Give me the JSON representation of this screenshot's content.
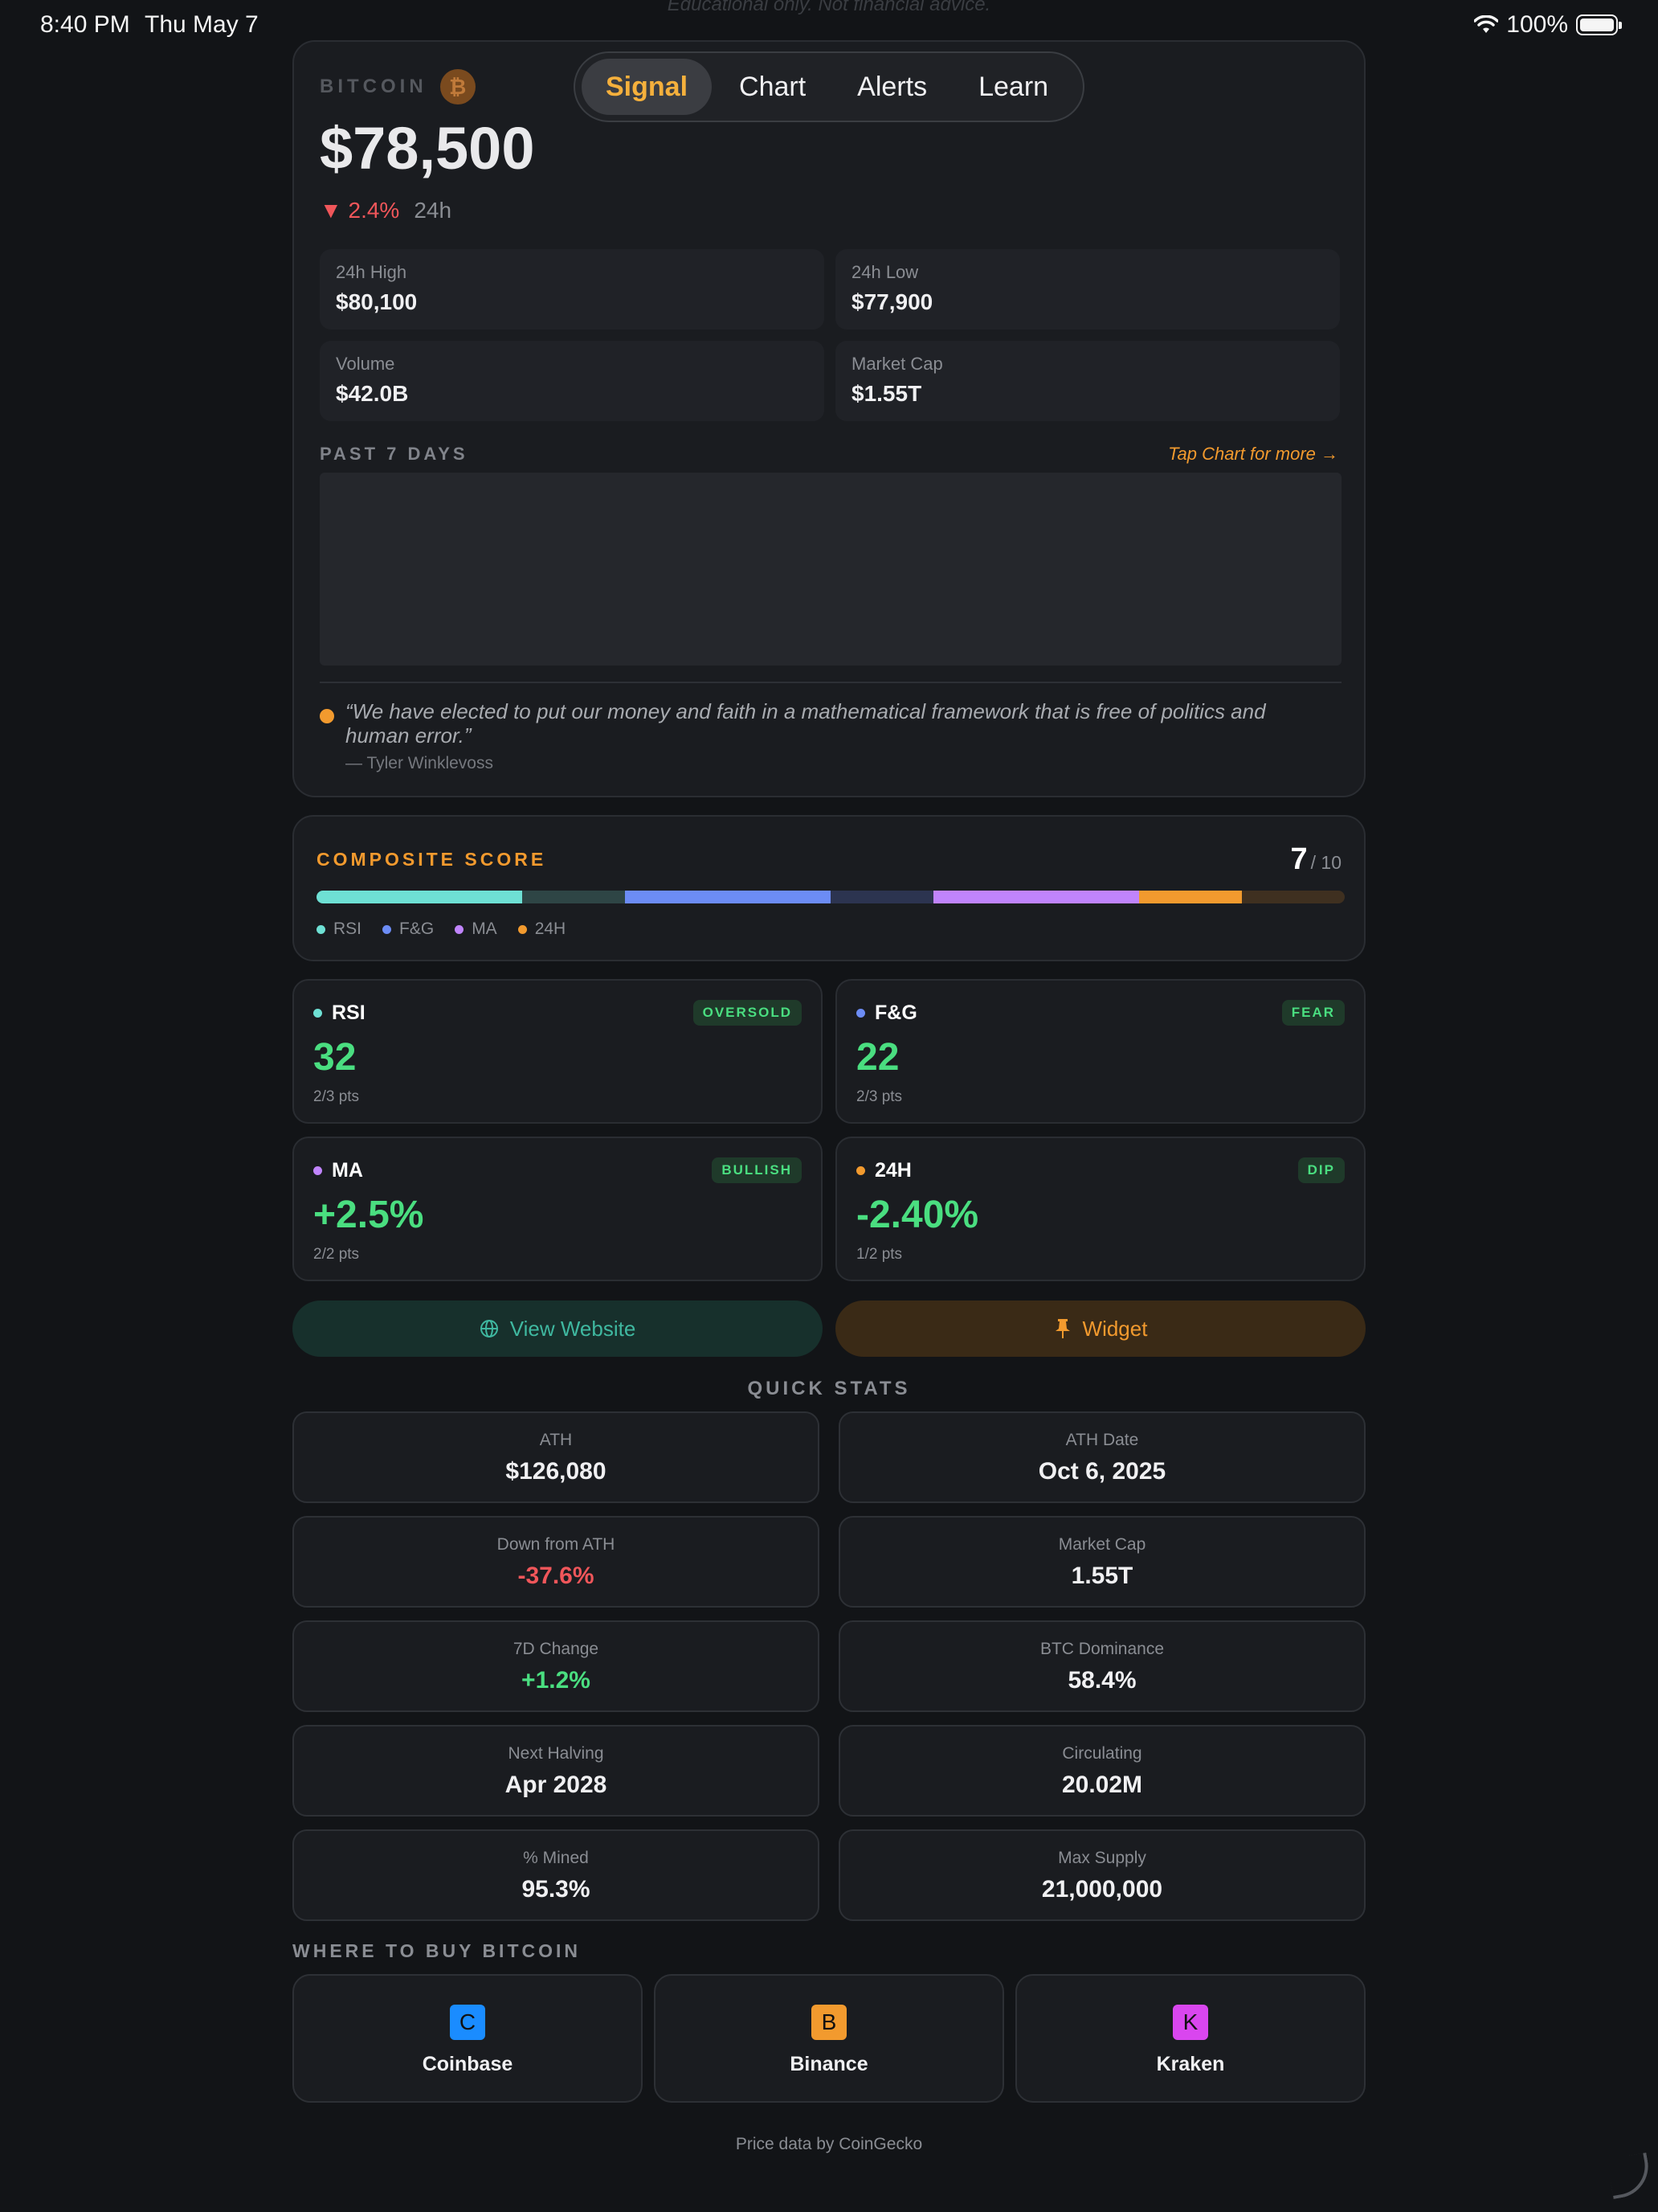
{
  "status_bar": {
    "time": "8:40 PM",
    "date": "Thu May 7",
    "battery": "100%"
  },
  "disclaimer": "Educational only. Not financial advice.",
  "tabs": [
    {
      "label": "Signal",
      "active": true
    },
    {
      "label": "Chart",
      "active": false
    },
    {
      "label": "Alerts",
      "active": false
    },
    {
      "label": "Learn",
      "active": false
    }
  ],
  "hero": {
    "coin_name": "BITCOIN",
    "coin_symbol": "₿",
    "price": "$78,500",
    "change_arrow": "▼",
    "change": "2.4%",
    "change_period": "24h",
    "stats": [
      {
        "label": "24h High",
        "value": "$80,100"
      },
      {
        "label": "24h Low",
        "value": "$77,900"
      },
      {
        "label": "Volume",
        "value": "$42.0B"
      },
      {
        "label": "Market Cap",
        "value": "$1.55T"
      }
    ],
    "past_label": "PAST 7 DAYS",
    "tap_chart": "Tap Chart for more →",
    "quote": "“We have elected to put our money and faith in a mathematical framework that is free of politics and human error.”",
    "quote_author": "— Tyler Winklevoss"
  },
  "composite": {
    "title": "COMPOSITE SCORE",
    "score": "7",
    "max": "/ 10",
    "segments": [
      {
        "name": "RSI",
        "earned": 2,
        "possible": 3,
        "color": "#6ee0d4",
        "dim": "#2e4545"
      },
      {
        "name": "F&G",
        "earned": 2,
        "possible": 3,
        "color": "#6c8cf5",
        "dim": "#2c3450"
      },
      {
        "name": "MA",
        "earned": 2,
        "possible": 2,
        "color": "#c084fc",
        "dim": "#3a2c4a"
      },
      {
        "name": "24H",
        "earned": 1,
        "possible": 2,
        "color": "#f29a2e",
        "dim": "#3f3020"
      }
    ],
    "legend": [
      {
        "label": "RSI",
        "color": "#6ee0d4"
      },
      {
        "label": "F&G",
        "color": "#6c8cf5"
      },
      {
        "label": "MA",
        "color": "#c084fc"
      },
      {
        "label": "24H",
        "color": "#f29a2e"
      }
    ]
  },
  "indicators": [
    {
      "name": "RSI",
      "color": "#6ee0d4",
      "badge": "OVERSOLD",
      "value": "32",
      "pts": "2/3 pts"
    },
    {
      "name": "F&G",
      "color": "#6c8cf5",
      "badge": "FEAR",
      "value": "22",
      "pts": "2/3 pts"
    },
    {
      "name": "MA",
      "color": "#c084fc",
      "badge": "BULLISH",
      "value": "+2.5%",
      "pts": "2/2 pts"
    },
    {
      "name": "24H",
      "color": "#f29a2e",
      "badge": "DIP",
      "value": "-2.40%",
      "pts": "1/2 pts"
    }
  ],
  "actions": {
    "website": "View Website",
    "widget": "Widget"
  },
  "quick_stats": {
    "title": "QUICK STATS",
    "items": [
      {
        "label": "ATH",
        "value": "$126,080",
        "tone": ""
      },
      {
        "label": "ATH Date",
        "value": "Oct 6, 2025",
        "tone": ""
      },
      {
        "label": "Down from ATH",
        "value": "-37.6%",
        "tone": "neg"
      },
      {
        "label": "Market Cap",
        "value": "1.55T",
        "tone": ""
      },
      {
        "label": "7D Change",
        "value": "+1.2%",
        "tone": "pos"
      },
      {
        "label": "BTC Dominance",
        "value": "58.4%",
        "tone": ""
      },
      {
        "label": "Next Halving",
        "value": "Apr 2028",
        "tone": ""
      },
      {
        "label": "Circulating",
        "value": "20.02M",
        "tone": ""
      },
      {
        "label": "% Mined",
        "value": "95.3%",
        "tone": ""
      },
      {
        "label": "Max Supply",
        "value": "21,000,000",
        "tone": ""
      }
    ]
  },
  "where_to_buy": {
    "title": "WHERE TO BUY BITCOIN",
    "exchanges": [
      {
        "letter": "C",
        "name": "Coinbase",
        "color": "#1a8cff"
      },
      {
        "letter": "B",
        "name": "Binance",
        "color": "#f29a2e"
      },
      {
        "letter": "K",
        "name": "Kraken",
        "color": "#d946ef"
      }
    ]
  },
  "footer": "Price data by CoinGecko"
}
